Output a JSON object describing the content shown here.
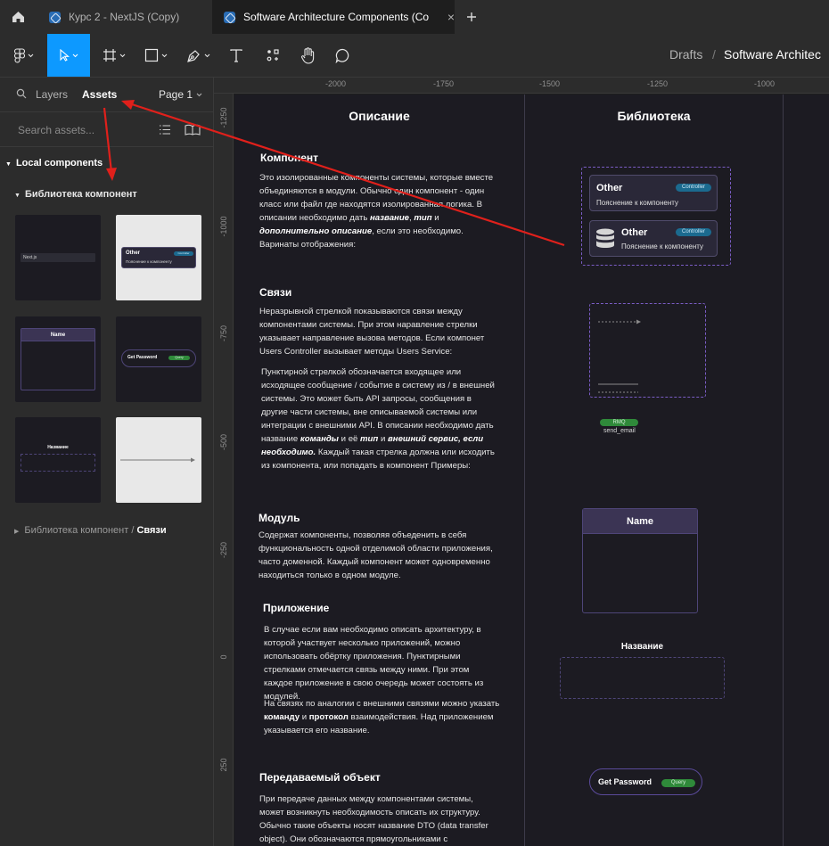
{
  "tabs": {
    "home_icon": "home-icon",
    "tab1": "Курс 2 - NextJS (Copy)",
    "tab2": "Software Architecture Components (Co",
    "new_tab_icon": "plus-icon"
  },
  "toolbar": {
    "breadcrumb_folder": "Drafts",
    "breadcrumb_sep": "/",
    "breadcrumb_file": "Software Architec"
  },
  "left_panel": {
    "tab_layers": "Layers",
    "tab_assets": "Assets",
    "page_label": "Page 1",
    "search_placeholder": "Search assets...",
    "local_components": "Local components",
    "library_group": "Библиотека компонент",
    "thumb_nextjs": "Next.js",
    "thumb_other": "Other",
    "thumb_controller": "Controller",
    "thumb_desc": "Пояснение к компоненту",
    "thumb_name": "Name",
    "thumb_get_password": "Get Password",
    "thumb_query": "Query",
    "thumb_nazvanie": "Название",
    "collapsed_group_prefix": "Библиотека компонент",
    "collapsed_group_sep": "/",
    "collapsed_group_leaf": "Связи"
  },
  "ruler": {
    "x_ticks": [
      "-2000",
      "-1750",
      "-1500",
      "-1250",
      "-1000"
    ],
    "y_ticks": [
      "-1250",
      "-1000",
      "-750",
      "-500",
      "-250",
      "0",
      "250"
    ]
  },
  "canvas": {
    "col_description": "Описание",
    "col_library": "Библиотека",
    "sections": {
      "component_title": "Компонент",
      "component_p1": "Это изолированные компоненты системы, которые вместе объединяются в модули. Обычно один компонент - один класс или файл где находятся изолированная логика. В описании необходимо дать ",
      "component_b1": "название",
      "component_p2": ", ",
      "component_b2": "тип",
      "component_p3": " и ",
      "component_b3": "дополнительно описание",
      "component_p4": ", если это необходимо. Варинаты отображения:",
      "links_title": "Связи",
      "links_p": "Неразрывной стрелкой показываются связи между компонентами системы. При этом наравление стрелки указывает направление вызова методов. Если компонет Users Controller вызывает методы Users Service:",
      "links_p2a": "Пунктирной стрелкой обозначается входящее или исходящее сообщение / событие в систему из / в внешней системы. Это может быть API запросы, сообщения в другие части системы, вне описываемой системы или интеграции с внешними API. В описании необходимо дать название ",
      "links_b1": "команды",
      "links_p2b": " и её ",
      "links_b2": "тип",
      "links_p2c": " и ",
      "links_b3": "внешний сервис, если необходимо.",
      "links_p2d": " Каждый такая стрелка должна или исходить из компонента, или попадать в компонент Примеры:",
      "module_title": "Модуль",
      "module_p": "Содержат компоненты, позволяя объеденить в себя функциональность одной отделимой области приложения, часто доменной. Каждый компонент может одновременно находиться только в одном модуле.",
      "app_title": "Приложение",
      "app_p1": "В случае если вам необходимо описать архитектуру, в которой участвует несколько приложений, можно использовать обёртку приложения. Пунктирными стрелками отмечается связь между ними. При этом каждое приложение в свою очередь может состоять из модулей.",
      "app_p2a": "На связях по аналогии с внешними связями можно указать ",
      "app_b1": "команду",
      "app_p2b": " и ",
      "app_b2": "протокол",
      "app_p2c": " взаимодействия. Над приложением указывается его название.",
      "dto_title": "Передаваемый объект",
      "dto_p": "При передаче данных между компонентами системы, может возникнуть необходимость описать их структуру. Обычно такие объекты носят название DTO (data transfer object). Они обозначаются прямоугольниками с закруглёнными на"
    },
    "library": {
      "other": "Other",
      "controller": "Controller",
      "desc": "Пояснение к компоненту",
      "rmq": "RMQ",
      "send_email": "send_email",
      "module_name": "Name",
      "app_name": "Название",
      "get_password": "Get Password",
      "query": "Query"
    }
  },
  "colors": {
    "annotation_arrow": "#e0201b",
    "accent_blue": "#0d99ff",
    "controller_pill": "#1b6a8f",
    "query_pill": "#2f8a3a",
    "module_header": "#3b3454"
  }
}
